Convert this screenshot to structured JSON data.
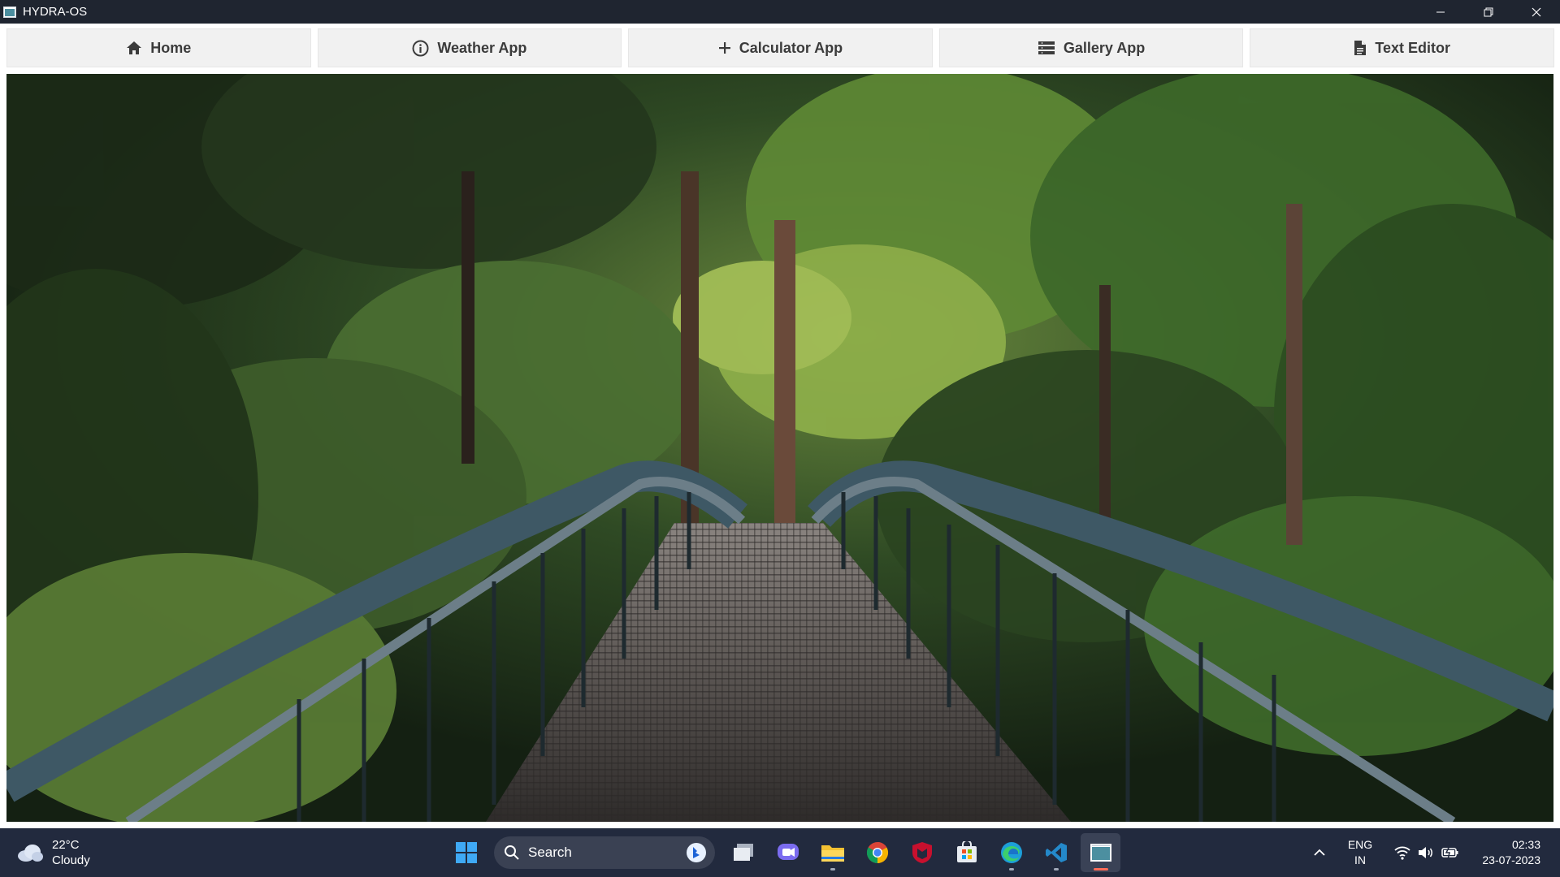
{
  "window": {
    "title": "HYDRA-OS",
    "controls": [
      "minimize",
      "restore",
      "close"
    ]
  },
  "nav": {
    "items": [
      {
        "label": "Home",
        "icon": "home-icon"
      },
      {
        "label": "Weather App",
        "icon": "info-icon"
      },
      {
        "label": "Calculator App",
        "icon": "plus-icon"
      },
      {
        "label": "Gallery App",
        "icon": "list-icon"
      },
      {
        "label": "Text Editor",
        "icon": "document-icon"
      }
    ]
  },
  "main": {
    "image": "forest-footbridge-photo"
  },
  "taskbar": {
    "weather": {
      "temp": "22°C",
      "condition": "Cloudy"
    },
    "search": {
      "placeholder": "Search"
    },
    "apps": [
      "start-icon",
      "task-view-icon",
      "chat-icon",
      "file-explorer-icon",
      "chrome-icon",
      "mcafee-icon",
      "store-icon",
      "edge-icon",
      "vscode-icon",
      "hydra-app-icon"
    ],
    "language": {
      "line1": "ENG",
      "line2": "IN"
    },
    "clock": {
      "time": "02:33",
      "date": "23-07-2023"
    }
  },
  "colors": {
    "titlebar": "#1f2530",
    "taskbar": "#222a3e",
    "nav_button": "#f1f1f1",
    "nav_text": "#3b3b3b",
    "active_indicator": "#ff6b57"
  }
}
